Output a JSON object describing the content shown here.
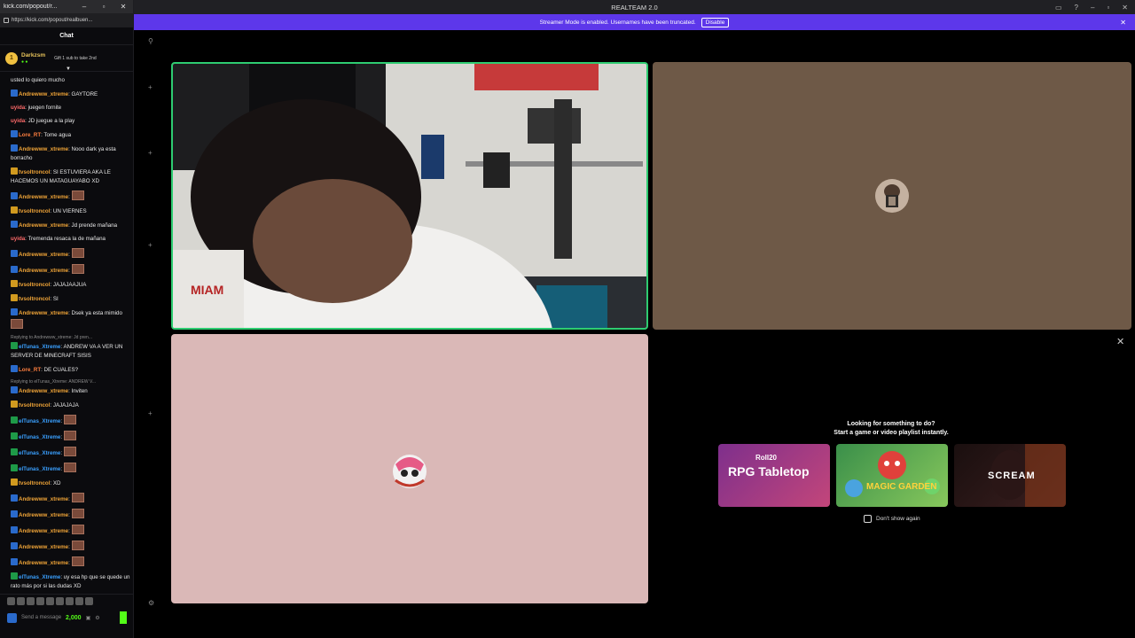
{
  "chat_window": {
    "title": "kick.com/popout/r...",
    "url": "https://kick.com/popout/realbuen...",
    "header": "Chat",
    "pinned": {
      "user": "Darkzsm",
      "text": "Gift 1 sub to take 2nd"
    },
    "messages": [
      {
        "user": "",
        "text": "usted lo quiero mucho",
        "color": "#e8e8e8",
        "badge": ""
      },
      {
        "user": "Andrewww_xtreme",
        "text": ": GAYTORE",
        "color": "#f1a538",
        "badge": "blue"
      },
      {
        "user": "uyida",
        "text": ": juegen fornite",
        "color": "#ff6a6a",
        "badge": ""
      },
      {
        "user": "uyida",
        "text": ": JD juegue a la play",
        "color": "#ff6a6a",
        "badge": ""
      },
      {
        "user": "Lore_RT",
        "text": ": Tome agua",
        "color": "#ff7f3f",
        "badge": "blue"
      },
      {
        "user": "Andrewww_xtreme",
        "text": ": Nooo dark ya esta borracho",
        "color": "#f1a538",
        "badge": "blue"
      },
      {
        "user": "tvsoltroncol",
        "text": ": SI ESTUVIERA AKA LE HACEMOS UN MATAGUAYABO XD",
        "color": "#f1a538",
        "badge": "gold"
      },
      {
        "user": "Andrewww_xtreme",
        "text": ":",
        "color": "#f1a538",
        "badge": "blue",
        "emote": true
      },
      {
        "user": "tvsoltroncol",
        "text": ": UN VIERNES",
        "color": "#f1a538",
        "badge": "gold"
      },
      {
        "user": "Andrewww_xtreme",
        "text": ": Jd prende mañana",
        "color": "#f1a538",
        "badge": "blue"
      },
      {
        "user": "uyida",
        "text": ": Tremenda resaca la de mañana",
        "color": "#ff6a6a",
        "badge": ""
      },
      {
        "user": "Andrewww_xtreme",
        "text": ":",
        "color": "#f1a538",
        "badge": "blue",
        "emote": true
      },
      {
        "user": "Andrewww_xtreme",
        "text": ":",
        "color": "#f1a538",
        "badge": "blue",
        "emote": true
      },
      {
        "user": "tvsoltroncol",
        "text": ": JAJAJAAJUA",
        "color": "#f1a538",
        "badge": "gold"
      },
      {
        "user": "tvsoltroncol",
        "text": ": SI",
        "color": "#f1a538",
        "badge": "gold"
      },
      {
        "user": "Andrewww_xtreme",
        "text": ": Dsek ya esta mimido",
        "color": "#f1a538",
        "badge": "blue",
        "emote": true
      },
      {
        "user": "elTunas_Xtreme",
        "text": ": ANDREW VA A VER UN SERVER DE MINECRAFT SISIS",
        "color": "#3aa0ff",
        "badge": "sp",
        "reply": "Replying to Andrewww_xtreme: Jd pren..."
      },
      {
        "user": "Lore_RT",
        "text": ": DE CUALES?",
        "color": "#ff7f3f",
        "badge": "blue"
      },
      {
        "user": "Andrewww_xtreme",
        "text": ": Inviten",
        "color": "#f1a538",
        "badge": "blue",
        "reply": "Replying to elTunas_Xtreme: ANDREW V..."
      },
      {
        "user": "tvsoltroncol",
        "text": ": JAJAJAJA",
        "color": "#f1a538",
        "badge": "gold"
      },
      {
        "user": "elTunas_Xtreme",
        "text": ":",
        "color": "#3aa0ff",
        "badge": "sp",
        "emote": true
      },
      {
        "user": "elTunas_Xtreme",
        "text": ":",
        "color": "#3aa0ff",
        "badge": "sp",
        "emote": true
      },
      {
        "user": "elTunas_Xtreme",
        "text": ":",
        "color": "#3aa0ff",
        "badge": "sp",
        "emote": true
      },
      {
        "user": "elTunas_Xtreme",
        "text": ":",
        "color": "#3aa0ff",
        "badge": "sp",
        "emote": true
      },
      {
        "user": "tvsoltroncol",
        "text": ": XD",
        "color": "#f1a538",
        "badge": "gold"
      },
      {
        "user": "Andrewww_xtreme",
        "text": ":",
        "color": "#f1a538",
        "badge": "blue",
        "emote": true
      },
      {
        "user": "Andrewww_xtreme",
        "text": ":",
        "color": "#f1a538",
        "badge": "blue",
        "emote": true
      },
      {
        "user": "Andrewww_xtreme",
        "text": ":",
        "color": "#f1a538",
        "badge": "blue",
        "emote": true
      },
      {
        "user": "Andrewww_xtreme",
        "text": ":",
        "color": "#f1a538",
        "badge": "blue",
        "emote": true
      },
      {
        "user": "Andrewww_xtreme",
        "text": ":",
        "color": "#f1a538",
        "badge": "blue",
        "emote": true
      },
      {
        "user": "elTunas_Xtreme",
        "text": ": uy esa hp que se quede un rato más por si las dudas XD",
        "color": "#3aa0ff",
        "badge": "sp"
      }
    ],
    "input_placeholder": "Send a message",
    "points": "2,000"
  },
  "app": {
    "title": "REALTEAM 2.0",
    "banner_text": "Streamer Mode is enabled. Usernames have been truncated.",
    "banner_button": "Disable"
  },
  "activity": {
    "prompt_line1": "Looking for something to do?",
    "prompt_line2": "Start a game or video playlist instantly.",
    "cards": [
      {
        "brand": "Roll20",
        "name": "RPG Tabletop"
      },
      {
        "name": "MAGIC GARDEN"
      },
      {
        "name": "SCREAM"
      }
    ],
    "dont_show": "Don't show again"
  },
  "colors": {
    "accent": "#5d37ea",
    "speaking": "#2ecc71",
    "kick_green": "#53fc18"
  }
}
